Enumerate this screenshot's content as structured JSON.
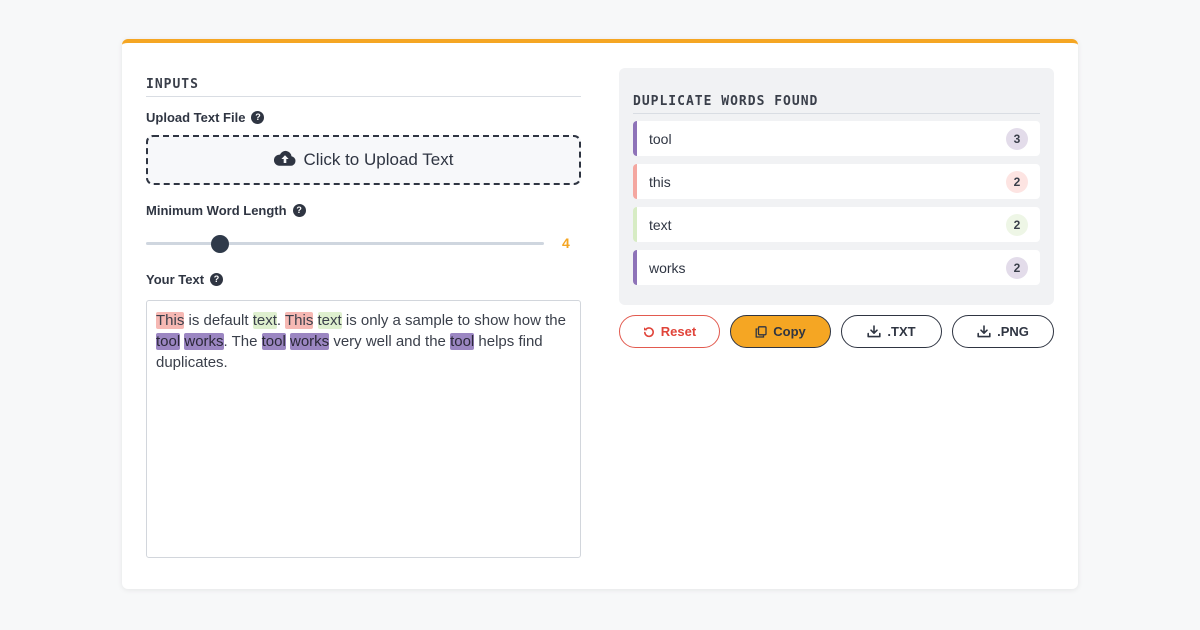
{
  "inputs": {
    "title": "INPUTS",
    "upload": {
      "label": "Upload Text File",
      "button_label": "Click to Upload Text"
    },
    "min_length": {
      "label": "Minimum Word Length",
      "value": "4",
      "slider_fraction": 0.17
    },
    "text": {
      "label": "Your Text",
      "segments": [
        {
          "t": "This",
          "hl": "this"
        },
        {
          "t": " is default "
        },
        {
          "t": "text",
          "hl": "text"
        },
        {
          "t": ". "
        },
        {
          "t": "This",
          "hl": "this"
        },
        {
          "t": " "
        },
        {
          "t": "text",
          "hl": "text"
        },
        {
          "t": " is only a sample to show how the "
        },
        {
          "t": "tool",
          "hl": "tool"
        },
        {
          "t": " "
        },
        {
          "t": "works",
          "hl": "works"
        },
        {
          "t": ". The "
        },
        {
          "t": "tool",
          "hl": "tool"
        },
        {
          "t": " "
        },
        {
          "t": "works",
          "hl": "works"
        },
        {
          "t": " very well and the "
        },
        {
          "t": "tool",
          "hl": "tool"
        },
        {
          "t": " helps find duplicates."
        }
      ]
    },
    "help_icon": "question-circle-icon"
  },
  "duplicates": {
    "title": "DUPLICATE WORDS FOUND",
    "items": [
      {
        "word": "tool",
        "count": "3",
        "accent": "#8e73b8",
        "badge": "#e3dcea"
      },
      {
        "word": "this",
        "count": "2",
        "accent": "#f4a7a0",
        "badge": "#fde4e2"
      },
      {
        "word": "text",
        "count": "2",
        "accent": "#d7ecc4",
        "badge": "#eef6e6"
      },
      {
        "word": "works",
        "count": "2",
        "accent": "#8e73b8",
        "badge": "#e3dcea"
      }
    ]
  },
  "actions": {
    "reset": "Reset",
    "copy": "Copy",
    "txt": ".TXT",
    "png": ".PNG"
  },
  "colors": {
    "accent": "#f5a623",
    "danger": "#e0443a",
    "dark": "#2f3542"
  }
}
